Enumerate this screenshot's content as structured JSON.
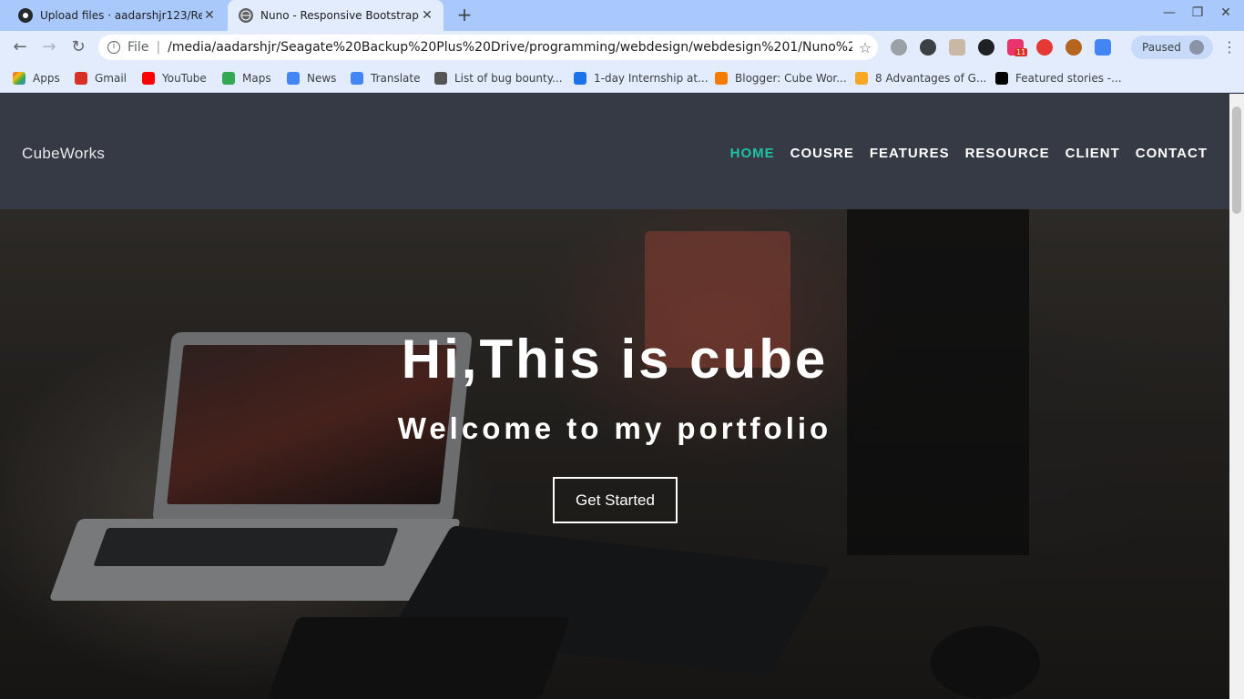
{
  "browser": {
    "tabs": [
      {
        "title": "Upload files · aadarshjr123/Res",
        "icon": "github-icon",
        "active": false
      },
      {
        "title": "Nuno - Responsive Bootstrap T",
        "icon": "globe-icon",
        "active": true
      }
    ],
    "new_tab_label": "+",
    "address": {
      "scheme": "File",
      "url": "/media/aadarshjr/Seagate%20Backup%20Plus%20Drive/programming/webdesign/webdesign%201/Nuno%2..."
    },
    "profile_label": "Paused",
    "extension_badge": "11",
    "bookmarks": [
      {
        "label": "Apps",
        "color": "#ea4335"
      },
      {
        "label": "Gmail",
        "color": "#d93025"
      },
      {
        "label": "YouTube",
        "color": "#ff0000"
      },
      {
        "label": "Maps",
        "color": "#34a853"
      },
      {
        "label": "News",
        "color": "#4285f4"
      },
      {
        "label": "Translate",
        "color": "#4285f4"
      },
      {
        "label": "List of bug bounty...",
        "color": "#555555"
      },
      {
        "label": "1-day Internship at...",
        "color": "#1a73e8"
      },
      {
        "label": "Blogger: Cube Wor...",
        "color": "#f57c00"
      },
      {
        "label": "8 Advantages of G...",
        "color": "#f9a825"
      },
      {
        "label": "Featured stories -...",
        "color": "#000000"
      }
    ]
  },
  "site": {
    "brand": "CubeWorks",
    "nav": [
      {
        "label": "HOME",
        "active": true
      },
      {
        "label": "COUSRE",
        "active": false
      },
      {
        "label": "FEATURES",
        "active": false
      },
      {
        "label": "RESOURCE",
        "active": false
      },
      {
        "label": "CLIENT",
        "active": false
      },
      {
        "label": "CONTACT",
        "active": false
      }
    ],
    "hero": {
      "title": "Hi,This is cube",
      "subtitle": "Welcome to my portfolio",
      "cta": "Get Started"
    },
    "colors": {
      "accent": "#1ec1a5",
      "header_bg": "#353a45"
    }
  }
}
